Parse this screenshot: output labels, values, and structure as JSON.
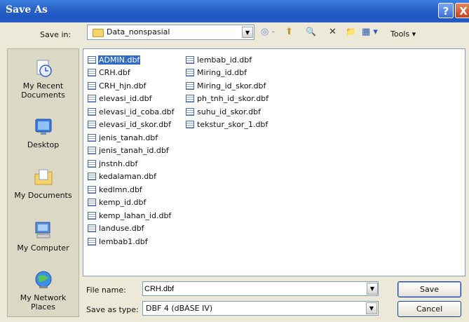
{
  "window": {
    "title": "Save As",
    "help": "?",
    "close": "X"
  },
  "save_in": {
    "label": "Save in:",
    "value": "Data_nonspasial",
    "arrow": "▼"
  },
  "toolbar": {
    "back": "◎ -",
    "up": "⬆",
    "search": "🔍",
    "delete": "✕",
    "new_folder": "📁",
    "views": "▦ ▾",
    "tools": "Tools ▾"
  },
  "places": [
    {
      "label": "My Recent Documents",
      "icon": "recent-documents-icon"
    },
    {
      "label": "Desktop",
      "icon": "desktop-icon"
    },
    {
      "label": "My Documents",
      "icon": "my-documents-icon"
    },
    {
      "label": "My Computer",
      "icon": "my-computer-icon"
    },
    {
      "label": "My Network Places",
      "icon": "network-places-icon"
    }
  ],
  "files": {
    "col1": [
      "ADMIN.dbf",
      "CRH.dbf",
      "CRH_hjn.dbf",
      "elevasi_id.dbf",
      "elevasi_id_coba.dbf",
      "elevasi_id_skor.dbf",
      "jenis_tanah.dbf",
      "jenis_tanah_id.dbf",
      "jnstnh.dbf",
      "kedalaman.dbf",
      "kedlmn.dbf",
      "kemp_id.dbf",
      "kemp_lahan_id.dbf",
      "landuse.dbf",
      "lembab1.dbf"
    ],
    "col2": [
      "lembab_id.dbf",
      "Miring_id.dbf",
      "Miring_id_skor.dbf",
      "ph_tnh_id_skor.dbf",
      "suhu_id_skor.dbf",
      "tekstur_skor_1.dbf"
    ],
    "selected": "CRH.dbf"
  },
  "file_name": {
    "label": "File name:",
    "value": "CRH.dbf"
  },
  "save_as_type": {
    "label": "Save as type:",
    "value": "DBF 4 (dBASE IV)"
  },
  "buttons": {
    "save": "Save",
    "cancel": "Cancel"
  }
}
